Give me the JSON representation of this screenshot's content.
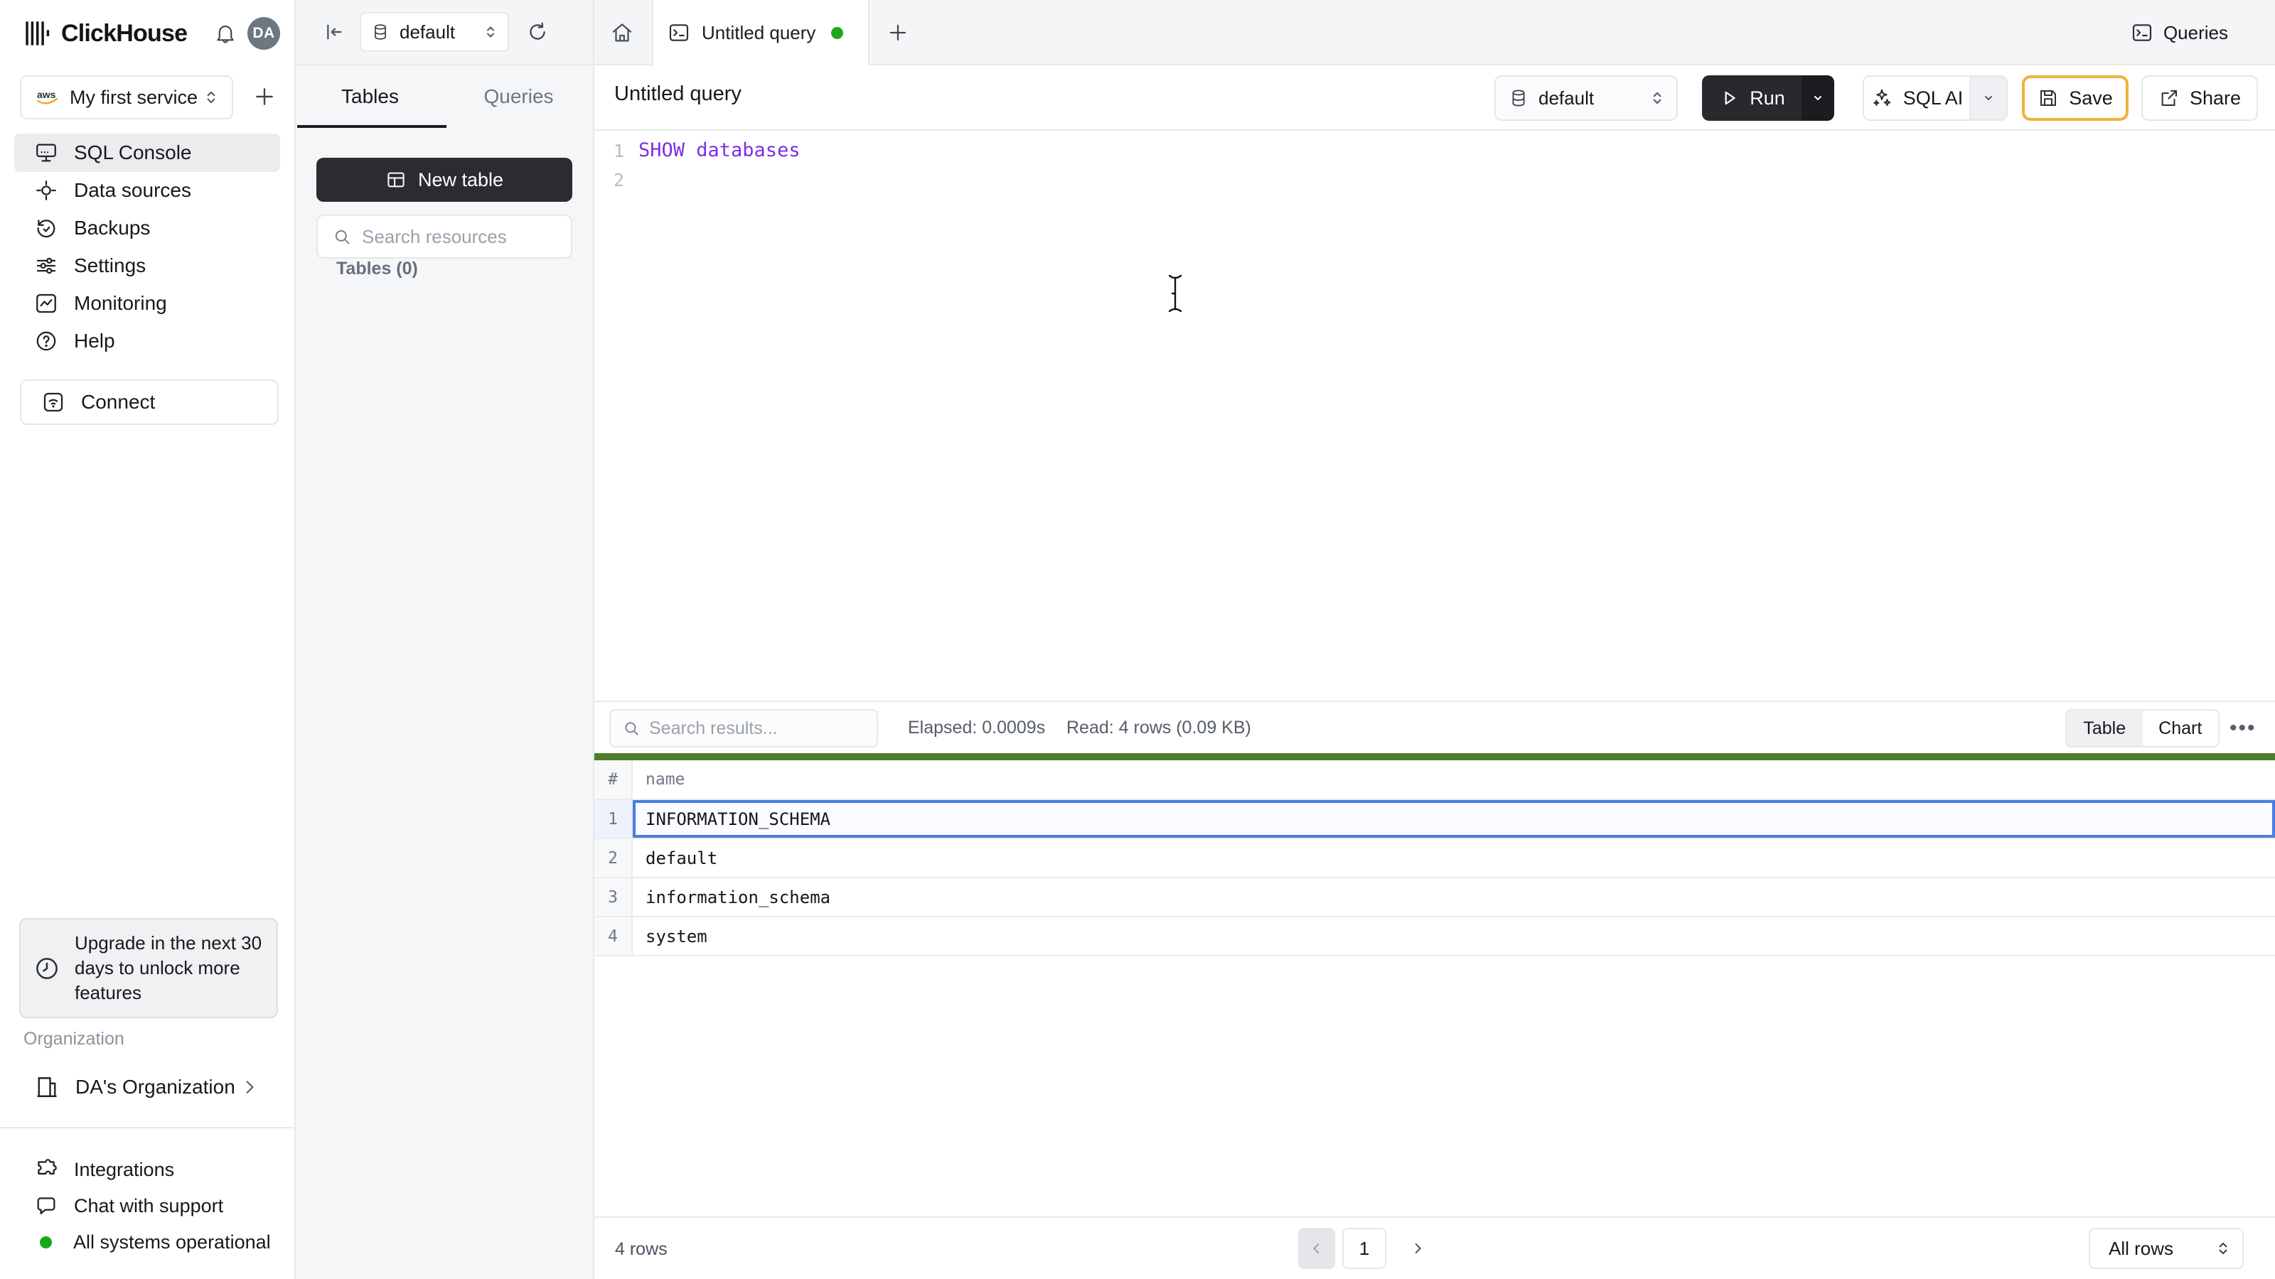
{
  "brand": {
    "name": "ClickHouse",
    "avatar_initials": "DA"
  },
  "sidebar": {
    "service": {
      "provider": "aws",
      "name": "My first service"
    },
    "nav": [
      {
        "label": "SQL Console",
        "active": true
      },
      {
        "label": "Data sources",
        "active": false
      },
      {
        "label": "Backups",
        "active": false
      },
      {
        "label": "Settings",
        "active": false
      },
      {
        "label": "Monitoring",
        "active": false
      },
      {
        "label": "Help",
        "active": false
      }
    ],
    "connect_label": "Connect",
    "upgrade_notice": "Upgrade in the next 30 days to unlock more features",
    "organization": {
      "heading": "Organization",
      "name": "DA's Organization"
    },
    "footer": {
      "integrations": "Integrations",
      "chat": "Chat with support",
      "status": "All systems operational"
    }
  },
  "resource_panel": {
    "tab_tables": "Tables",
    "tab_queries": "Queries",
    "new_table_label": "New table",
    "search_placeholder": "Search resources",
    "tables_count": "Tables (0)"
  },
  "topbar": {
    "database": "default",
    "tab_title": "Untitled query",
    "queries_label": "Queries"
  },
  "query_header": {
    "title": "Untitled query",
    "database": "default",
    "run": "Run",
    "sql_ai": "SQL AI",
    "save": "Save",
    "share": "Share"
  },
  "editor": {
    "lines": [
      {
        "n": "1",
        "code": "SHOW databases"
      },
      {
        "n": "2",
        "code": ""
      }
    ]
  },
  "results": {
    "search_placeholder": "Search results...",
    "elapsed": "Elapsed: 0.0009s",
    "read": "Read: 4 rows (0.09 KB)",
    "toggle_table": "Table",
    "toggle_chart": "Chart",
    "table": {
      "col_hash": "#",
      "col_name": "name",
      "rows": [
        {
          "n": "1",
          "name": "INFORMATION_SCHEMA",
          "selected": true
        },
        {
          "n": "2",
          "name": "default",
          "selected": false
        },
        {
          "n": "3",
          "name": "information_schema",
          "selected": false
        },
        {
          "n": "4",
          "name": "system",
          "selected": false
        }
      ]
    },
    "footer": {
      "count": "4 rows",
      "page": "1",
      "page_size": "All rows"
    }
  },
  "colors": {
    "accent_green_bar": "#4f7d2d",
    "selection_blue": "#4c7be0",
    "save_border_gold": "#f0b13c",
    "sql_keyword_purple": "#7c30e2",
    "status_green": "#17a817",
    "dark_button": "#28282d"
  }
}
